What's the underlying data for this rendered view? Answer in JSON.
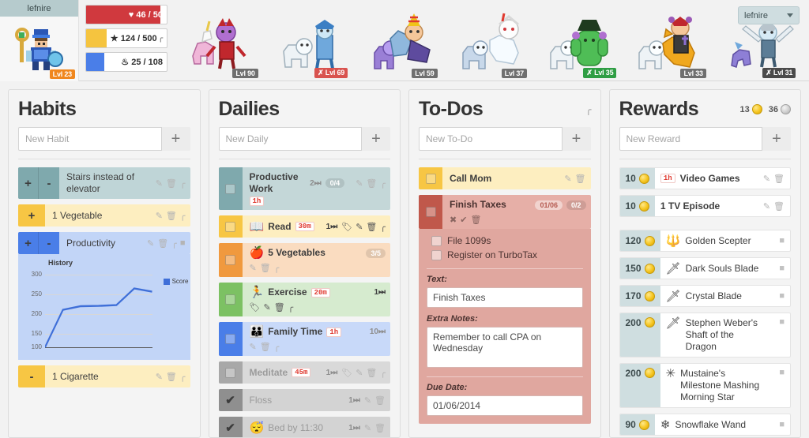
{
  "topbar": {
    "username": "lefnire",
    "user_menu_label": "lefnire",
    "avatar_level": "Lvl 23",
    "avatar_icon": "warrior-avatar",
    "stats": [
      {
        "name": "health",
        "icon": "heart-icon",
        "value": "46 / 50",
        "percent": 92,
        "color": "#d0393e",
        "label_color": "white",
        "has_chart_icon": false
      },
      {
        "name": "experience",
        "icon": "star-icon",
        "value": "124 / 500",
        "percent": 25,
        "color": "#f5c43f",
        "label_color": "dark",
        "has_chart_icon": true
      },
      {
        "name": "mana",
        "icon": "flame-icon",
        "value": "25 / 108",
        "percent": 23,
        "color": "#4a7ee8",
        "label_color": "dark",
        "has_chart_icon": false
      }
    ],
    "party": [
      {
        "name": "member-1",
        "icon": "unicorn-devil-pet",
        "level": "Lvl 90",
        "badge_style": "grey",
        "badge_icon": ""
      },
      {
        "name": "member-2",
        "icon": "bear-ice-mage-pet",
        "level": "Lvl 69",
        "badge_style": "red",
        "badge_icon": "✙"
      },
      {
        "name": "member-3",
        "icon": "party-hat-dragon-pet",
        "level": "Lvl 59",
        "badge_style": "grey",
        "badge_icon": ""
      },
      {
        "name": "member-4",
        "icon": "white-lion-rider",
        "level": "Lvl 37",
        "badge_style": "grey",
        "badge_icon": ""
      },
      {
        "name": "member-5",
        "icon": "green-cactus-mage",
        "level": "Lvl 35",
        "badge_style": "green",
        "badge_icon": "✙"
      },
      {
        "name": "member-6",
        "icon": "fox-knight-rider",
        "level": "Lvl 33",
        "badge_style": "grey",
        "badge_icon": ""
      },
      {
        "name": "member-7",
        "icon": "winged-sword-rogue",
        "level": "Lvl 31",
        "badge_style": "dark",
        "badge_icon": "✙"
      }
    ]
  },
  "habits": {
    "title": "Habits",
    "new_placeholder": "New Habit",
    "add_label": "+",
    "items": [
      {
        "text": "Stairs instead of elevator",
        "bg": "#bfd5d7",
        "ctrl_bg": "#7fa9ad",
        "up": "+",
        "down": "-",
        "has_up": true,
        "has_down": true,
        "actions": [
          "edit-icon",
          "delete-icon",
          "stats-icon"
        ]
      },
      {
        "text": "1 Vegetable",
        "bg": "#fdeec0",
        "ctrl_bg": "#f7c644",
        "up": "+",
        "down": "-",
        "has_up": true,
        "has_down": false,
        "actions": [
          "edit-icon",
          "delete-icon",
          "stats-icon"
        ]
      },
      {
        "text": "Productivity",
        "bg": "#c2d5f7",
        "ctrl_bg": "#4a7ee8",
        "up": "+",
        "down": "-",
        "has_up": true,
        "has_down": true,
        "actions": [
          "edit-icon",
          "delete-icon",
          "stats-icon",
          "comment-icon"
        ],
        "expanded_chart": true
      },
      {
        "text": "1 Cigarette",
        "bg": "#fdeec0",
        "ctrl_bg": "#f7c644",
        "up": "",
        "down": "-",
        "has_up": false,
        "has_down": true,
        "actions": [
          "edit-icon",
          "delete-icon",
          "stats-icon"
        ]
      }
    ]
  },
  "chart_data": {
    "type": "line",
    "title": "History",
    "xlabel": "",
    "ylabel": "",
    "ylim": [
      100,
      300
    ],
    "ticks": [
      "300",
      "250",
      "200",
      "150",
      "100"
    ],
    "legend": [
      "Score"
    ],
    "legend_position": "right",
    "grid": true,
    "series": [
      {
        "name": "Score",
        "color": "#3f6fd8",
        "x": [
          0,
          1,
          2,
          3,
          4,
          5,
          6
        ],
        "values": [
          100,
          203,
          213,
          214,
          216,
          262,
          253
        ]
      }
    ]
  },
  "dailies": {
    "title": "Dailies",
    "new_placeholder": "New Daily",
    "add_label": "+",
    "items": [
      {
        "text": "Productive Work",
        "emoji": "",
        "tag": "1h",
        "streak": "2",
        "checklist": "0/4",
        "bg": "#c4d7d8",
        "ctrl_bg": "#7fa9ad",
        "completed": false,
        "dim": false,
        "actions": [
          "edit-icon",
          "delete-icon",
          "stats-icon"
        ],
        "two_line": true
      },
      {
        "text": "Read",
        "emoji": "📖",
        "tag": "30m",
        "streak": "1",
        "checklist": "",
        "bg": "#fdeec0",
        "ctrl_bg": "#f7c644",
        "completed": false,
        "dim": false,
        "actions": [
          "tag-icon",
          "edit-icon",
          "delete-icon",
          "stats-icon"
        ],
        "two_line": false
      },
      {
        "text": "5 Vegetables",
        "emoji": "🍎",
        "tag": "",
        "streak": "",
        "checklist": "3/5",
        "bg": "#fadcc0",
        "ctrl_bg": "#f0993e",
        "completed": false,
        "dim": false,
        "actions": [
          "edit-icon",
          "delete-icon",
          "stats-icon"
        ],
        "two_line": false
      },
      {
        "text": "Exercise",
        "emoji": "🏃",
        "tag": "20m",
        "streak": "1",
        "checklist": "",
        "bg": "#d6ebcf",
        "ctrl_bg": "#7cc163",
        "completed": false,
        "dim": false,
        "actions": [
          "tag-icon",
          "edit-icon",
          "delete-icon",
          "stats-icon"
        ],
        "two_line": false
      },
      {
        "text": "Family Time",
        "emoji": "👪",
        "tag": "1h",
        "streak": "10",
        "checklist": "",
        "bg": "#c8d9f9",
        "ctrl_bg": "#4a7ee8",
        "completed": false,
        "dim": false,
        "actions": [
          "edit-icon",
          "delete-icon",
          "stats-icon"
        ],
        "two_line": false
      },
      {
        "text": "Meditate",
        "emoji": "",
        "tag": "45m",
        "streak": "1",
        "checklist": "",
        "bg": "#d9d9d9",
        "ctrl_bg": "#a8a8a8",
        "completed": false,
        "dim": true,
        "actions": [
          "tag-icon",
          "edit-icon",
          "delete-icon",
          "stats-icon"
        ],
        "two_line": false
      },
      {
        "text": "Floss",
        "emoji": "",
        "tag": "",
        "streak": "1",
        "checklist": "",
        "bg": "#d3d3d3",
        "ctrl_bg": "#8f8f8f",
        "completed": true,
        "dim": true,
        "actions": [
          "edit-icon",
          "delete-icon"
        ],
        "two_line": false
      },
      {
        "text": "Bed by 11:30",
        "emoji": "😴",
        "tag": "",
        "streak": "1",
        "checklist": "",
        "bg": "#d3d3d3",
        "ctrl_bg": "#8f8f8f",
        "completed": true,
        "dim": true,
        "actions": [
          "edit-icon",
          "delete-icon"
        ],
        "two_line": false
      }
    ]
  },
  "todos": {
    "title": "To-Dos",
    "new_placeholder": "New To-Do",
    "add_label": "+",
    "header_icon": "stats-icon",
    "items": [
      {
        "text": "Call Mom",
        "bg": "#fdeec0",
        "ctrl_bg": "#f7c644",
        "date": "",
        "checklist": "",
        "actions": [
          "edit-icon",
          "delete-icon"
        ]
      },
      {
        "text": "Finish Taxes",
        "bg": "#e6afa7",
        "ctrl_bg": "#c0584b",
        "date": "01/06",
        "checklist": "0/2",
        "actions": [
          "expand-icon",
          "done-icon",
          "delete-icon"
        ],
        "expanded": true
      }
    ],
    "detail": {
      "subtasks": [
        {
          "label": "File 1099s",
          "checked": false
        },
        {
          "label": "Register on TurboTax",
          "checked": false
        }
      ],
      "text_label": "Text:",
      "text_value": "Finish Taxes",
      "notes_label": "Extra Notes:",
      "notes_value": "Remember to call CPA on Wednesday",
      "due_label": "Due Date:",
      "due_value": "01/06/2014"
    }
  },
  "rewards": {
    "title": "Rewards",
    "new_placeholder": "New Reward",
    "add_label": "+",
    "gold": "13",
    "silver": "36",
    "items": [
      {
        "cost": "10",
        "icon": "",
        "tag": "1h",
        "name": "Video Games",
        "actions": [
          "edit-icon",
          "delete-icon"
        ],
        "custom": true
      },
      {
        "cost": "10",
        "icon": "",
        "tag": "",
        "name": "1 TV Episode",
        "actions": [
          "edit-icon",
          "delete-icon"
        ],
        "custom": true
      },
      {
        "cost": "120",
        "icon": "🔱",
        "tag": "",
        "name": "Golden Scepter",
        "actions": [
          "comment-icon"
        ],
        "custom": false
      },
      {
        "cost": "150",
        "icon": "🗡",
        "tag": "",
        "name": "Dark Souls Blade",
        "actions": [
          "comment-icon"
        ],
        "custom": false
      },
      {
        "cost": "170",
        "icon": "🗡",
        "tag": "",
        "name": "Crystal Blade",
        "actions": [
          "comment-icon"
        ],
        "custom": false
      },
      {
        "cost": "200",
        "icon": "🗡",
        "tag": "",
        "name": "Stephen Weber's Shaft of the Dragon",
        "actions": [
          "comment-icon"
        ],
        "custom": false
      },
      {
        "cost": "200",
        "icon": "✳",
        "tag": "",
        "name": "Mustaine's Milestone Mashing Morning Star",
        "actions": [
          "comment-icon"
        ],
        "custom": false
      },
      {
        "cost": "90",
        "icon": "❄",
        "tag": "",
        "name": "Snowflake Wand",
        "actions": [
          "comment-icon"
        ],
        "custom": false
      }
    ]
  },
  "icons": {
    "edit": "✎",
    "delete": "🗑",
    "stats": "◥",
    "comment": "■",
    "tag": "🏷",
    "expand": "✖",
    "done": "✔",
    "streak_arrow": "≫",
    "plus": "+",
    "check": "✔"
  }
}
